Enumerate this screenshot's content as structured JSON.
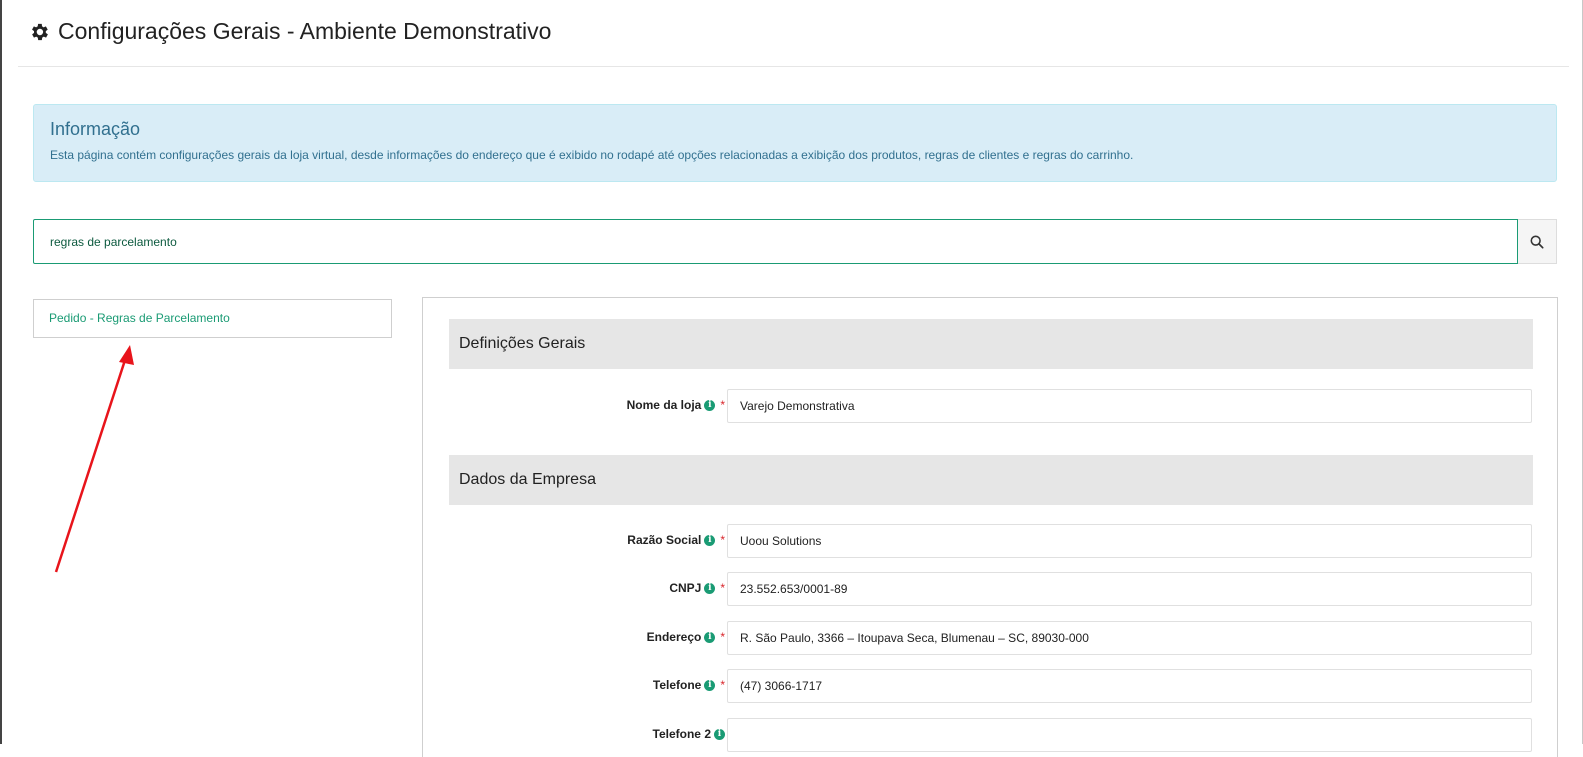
{
  "header": {
    "title": "Configurações Gerais - Ambiente Demonstrativo",
    "icon": "gear-icon"
  },
  "info_alert": {
    "title": "Informação",
    "text": "Esta página contém configurações gerais da loja virtual, desde informações do endereço que é exibido no rodapé até opções relacionadas a exibição dos produtos, regras de clientes e regras do carrinho."
  },
  "search": {
    "value": "regras de parcelamento",
    "button_icon": "search-icon"
  },
  "results": {
    "items": [
      {
        "label": "Pedido - Regras de Parcelamento"
      }
    ]
  },
  "sections": [
    {
      "title": "Definições Gerais"
    },
    {
      "title": "Dados da Empresa"
    }
  ],
  "fields": [
    {
      "label": "Nome da loja",
      "value": "Varejo Demonstrativa",
      "required": "*"
    },
    {
      "label": "Razão Social",
      "value": "Uoou Solutions",
      "required": "*"
    },
    {
      "label": "CNPJ",
      "value": "23.552.653/0001-89",
      "required": "*"
    },
    {
      "label": "Endereço",
      "value": "R. São Paulo, 3366 – Itoupava Seca, Blumenau – SC, 89030-000",
      "required": "*"
    },
    {
      "label": "Telefone",
      "value": "(47) 3066-1717",
      "required": "*"
    },
    {
      "label": "Telefone 2",
      "value": ""
    }
  ],
  "colors": {
    "accent": "#1a9b74",
    "info_bg": "#d9edf7",
    "info_text": "#31708f",
    "required": "#d9252b",
    "annotation_arrow": "#e8141b"
  }
}
